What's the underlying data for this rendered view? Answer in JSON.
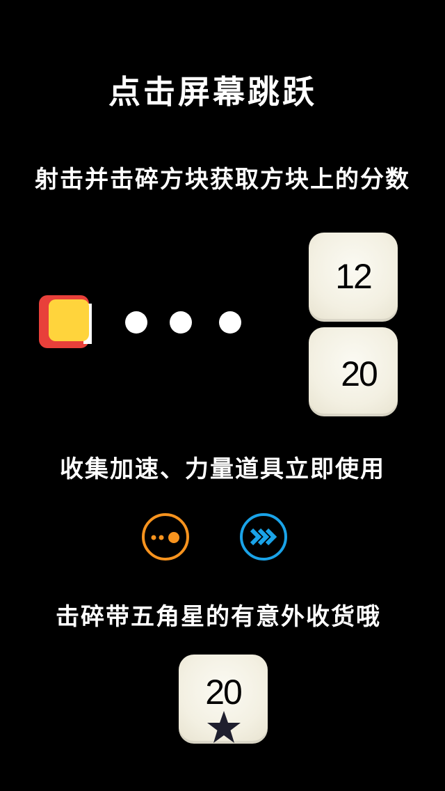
{
  "tutorial": {
    "title": "点击屏幕跳跃",
    "shoot_hint": "射击并击碎方块获取方块上的分数",
    "powerup_hint": "收集加速、力量道具立即使用",
    "star_hint": "击碎带五角星的有意外收货哦"
  },
  "player": {
    "front_color": "#ffd43c",
    "back_color": "#e8403a",
    "side_color": "#ffffff"
  },
  "bullets": {
    "count": 3,
    "color": "#ffffff"
  },
  "blocks": [
    {
      "value": "12"
    },
    {
      "value": "20"
    }
  ],
  "powerups": [
    {
      "icon": "dots-icon",
      "color": "#f7931e"
    },
    {
      "icon": "fast-forward-icon",
      "color": "#1aa3e8"
    }
  ],
  "star_block": {
    "value": "20",
    "icon": "star-icon",
    "star_color": "#1f1f2e"
  }
}
